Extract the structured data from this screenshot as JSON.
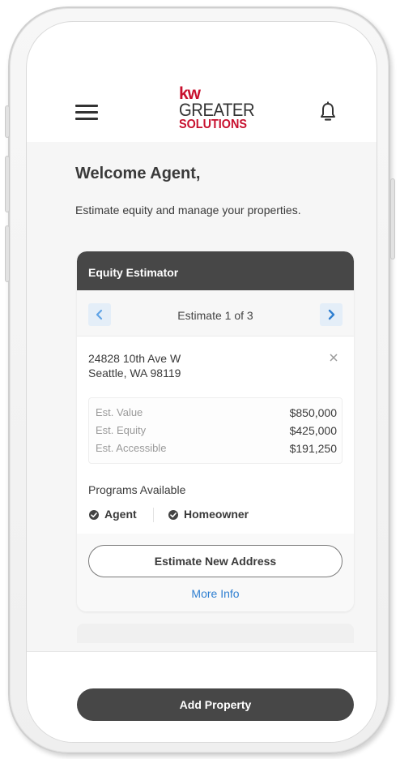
{
  "header": {
    "logo": {
      "kw": "kw",
      "line1": "GREATER",
      "line2": "SOLUTIONS"
    },
    "menu_icon": "hamburger-menu-icon",
    "notification_icon": "bell-icon"
  },
  "welcome": {
    "title": "Welcome Agent,",
    "subtitle": "Estimate equity and manage your properties."
  },
  "estimator": {
    "title": "Equity Estimator",
    "pager_label": "Estimate 1 of 3",
    "address_line1": "24828 10th Ave W",
    "address_line2": "Seattle, WA 98119",
    "rows": [
      {
        "label": "Est. Value",
        "value": "$850,000"
      },
      {
        "label": "Est. Equity",
        "value": "$425,000"
      },
      {
        "label": "Est. Accessible",
        "value": "$191,250"
      }
    ],
    "programs_label": "Programs Available",
    "programs": [
      {
        "label": "Agent"
      },
      {
        "label": "Homeowner"
      }
    ],
    "estimate_button": "Estimate New Address",
    "more_info": "More Info"
  },
  "footer": {
    "add_button": "Add Property"
  },
  "colors": {
    "brand_red": "#c8102e",
    "dark_header": "#474747",
    "link_blue": "#2f7fd1",
    "nav_button_bg": "#e4eef8"
  }
}
